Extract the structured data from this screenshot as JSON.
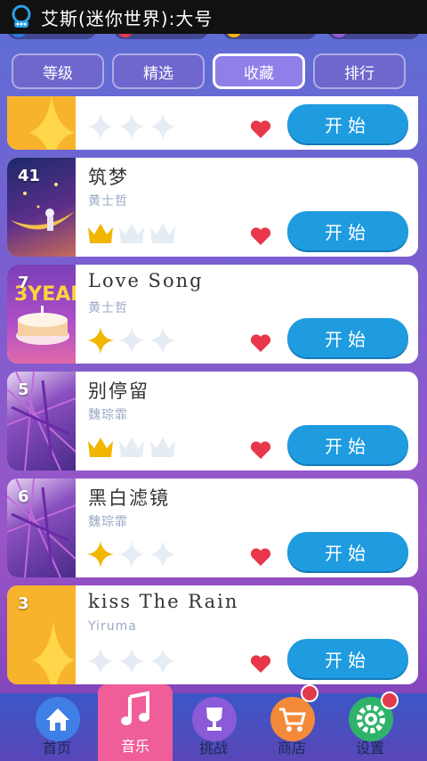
{
  "status_bar": {
    "title": "艾斯(迷你世界):大号"
  },
  "tabs": [
    {
      "label": "等级",
      "active": false
    },
    {
      "label": "精选",
      "active": false
    },
    {
      "label": "收藏",
      "active": true
    },
    {
      "label": "排行",
      "active": false
    }
  ],
  "songs": [
    {
      "number": "",
      "title": "",
      "artist": "",
      "rating": {
        "type": "star",
        "filled": 0
      },
      "favorite": true,
      "button_label": "开始"
    },
    {
      "number": "41",
      "title": "筑梦",
      "artist": "黄士哲",
      "rating": {
        "type": "crown",
        "filled": 1
      },
      "favorite": true,
      "button_label": "开始"
    },
    {
      "number": "7",
      "title": "Love Song",
      "artist": "黄士哲",
      "rating": {
        "type": "star",
        "filled": 1
      },
      "favorite": true,
      "button_label": "开始"
    },
    {
      "number": "5",
      "title": "别停留",
      "artist": "魏琮霏",
      "rating": {
        "type": "crown",
        "filled": 1
      },
      "favorite": true,
      "button_label": "开始"
    },
    {
      "number": "6",
      "title": "黑白滤镜",
      "artist": "魏琮霏",
      "rating": {
        "type": "star",
        "filled": 1
      },
      "favorite": true,
      "button_label": "开始"
    },
    {
      "number": "3",
      "title": "kiss The Rain",
      "artist": "Yiruma",
      "rating": {
        "type": "star",
        "filled": 0
      },
      "favorite": true,
      "button_label": "开始"
    }
  ],
  "nav": [
    {
      "label": "首页",
      "icon": "home-icon",
      "active": false,
      "badge": false
    },
    {
      "label": "音乐",
      "icon": "music-note-icon",
      "active": true,
      "badge": false
    },
    {
      "label": "挑战",
      "icon": "trophy-icon",
      "active": false,
      "badge": false
    },
    {
      "label": "商店",
      "icon": "cart-icon",
      "active": false,
      "badge": true
    },
    {
      "label": "设置",
      "icon": "gear-icon",
      "active": false,
      "badge": true
    }
  ],
  "colors": {
    "accent_blue": "#1f9be0",
    "heart_red": "#e8374b",
    "gold": "#f2b600",
    "nav_active": "#ef5e98"
  }
}
